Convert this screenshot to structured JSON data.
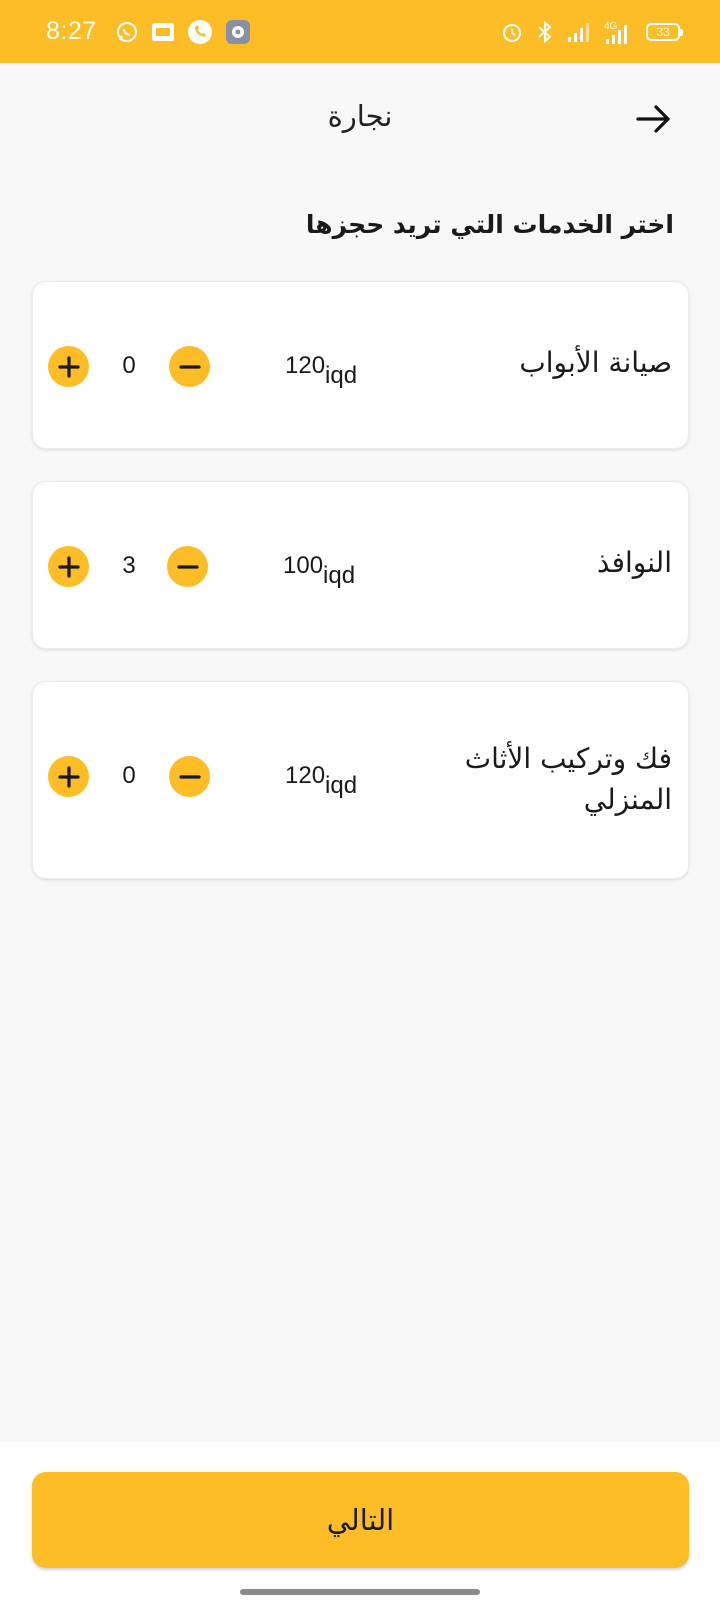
{
  "status_bar": {
    "time": "8:27",
    "battery": "33",
    "network": "4G",
    "left_icons": [
      "whatsapp-icon",
      "gallery-icon",
      "phone-icon",
      "settings-icon"
    ],
    "right_icons": [
      "alarm-icon",
      "bluetooth-icon",
      "signal-icon",
      "signal-4g-icon",
      "battery-icon"
    ]
  },
  "header": {
    "title": "نجارة",
    "back_icon": "arrow-right-icon"
  },
  "section_title": "اختر الخدمات التي تريد حجزها",
  "services": [
    {
      "name": "صيانة الأبواب",
      "price": "120",
      "currency": "iqd",
      "quantity": "0"
    },
    {
      "name": "النوافذ",
      "price": "100",
      "currency": "iqd",
      "quantity": "3"
    },
    {
      "name": "فك وتركيب الأثاث المنزلي",
      "price": "120",
      "currency": "iqd",
      "quantity": "0"
    }
  ],
  "next_button": {
    "label": "التالي"
  },
  "colors": {
    "accent": "#fdbd26",
    "background": "#f8f8f8",
    "card": "#ffffff",
    "text": "#1a1a1a"
  }
}
